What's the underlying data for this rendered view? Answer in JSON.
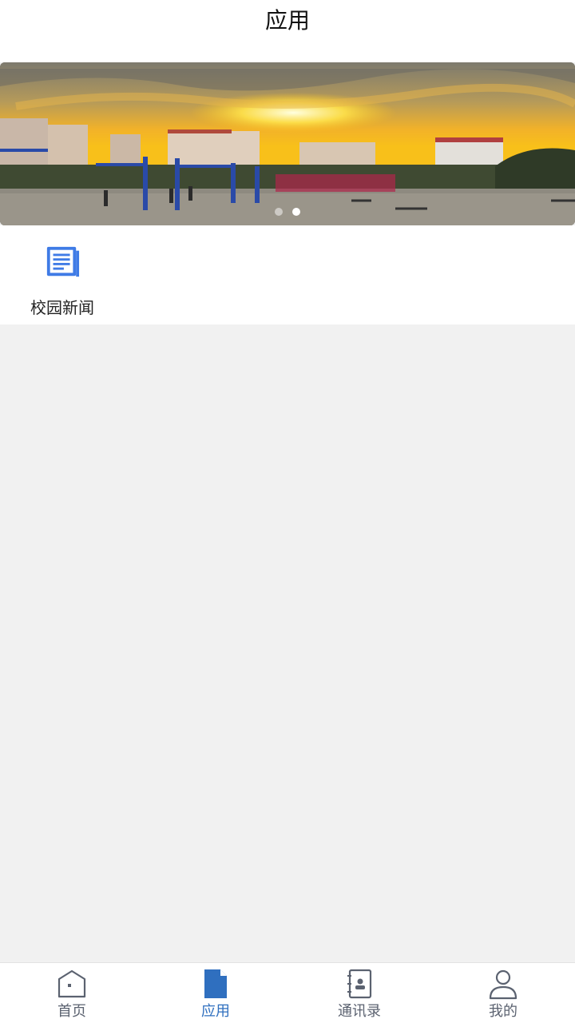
{
  "header": {
    "title": "应用"
  },
  "banner": {
    "dots": 2,
    "active_index": 1
  },
  "apps": [
    {
      "label": "校园新闻",
      "icon": "news-icon"
    }
  ],
  "tabbar": {
    "items": [
      {
        "label": "首页",
        "icon": "home-icon",
        "active": false
      },
      {
        "label": "应用",
        "icon": "file-icon",
        "active": true
      },
      {
        "label": "通讯录",
        "icon": "contacts-icon",
        "active": false
      },
      {
        "label": "我的",
        "icon": "user-icon",
        "active": false
      }
    ],
    "active_color": "#2f6fbf",
    "inactive_color": "#5b6270"
  },
  "colors": {
    "accent": "#2f6fbf",
    "news_icon": "#3f7be6",
    "background": "#f1f1f1"
  }
}
